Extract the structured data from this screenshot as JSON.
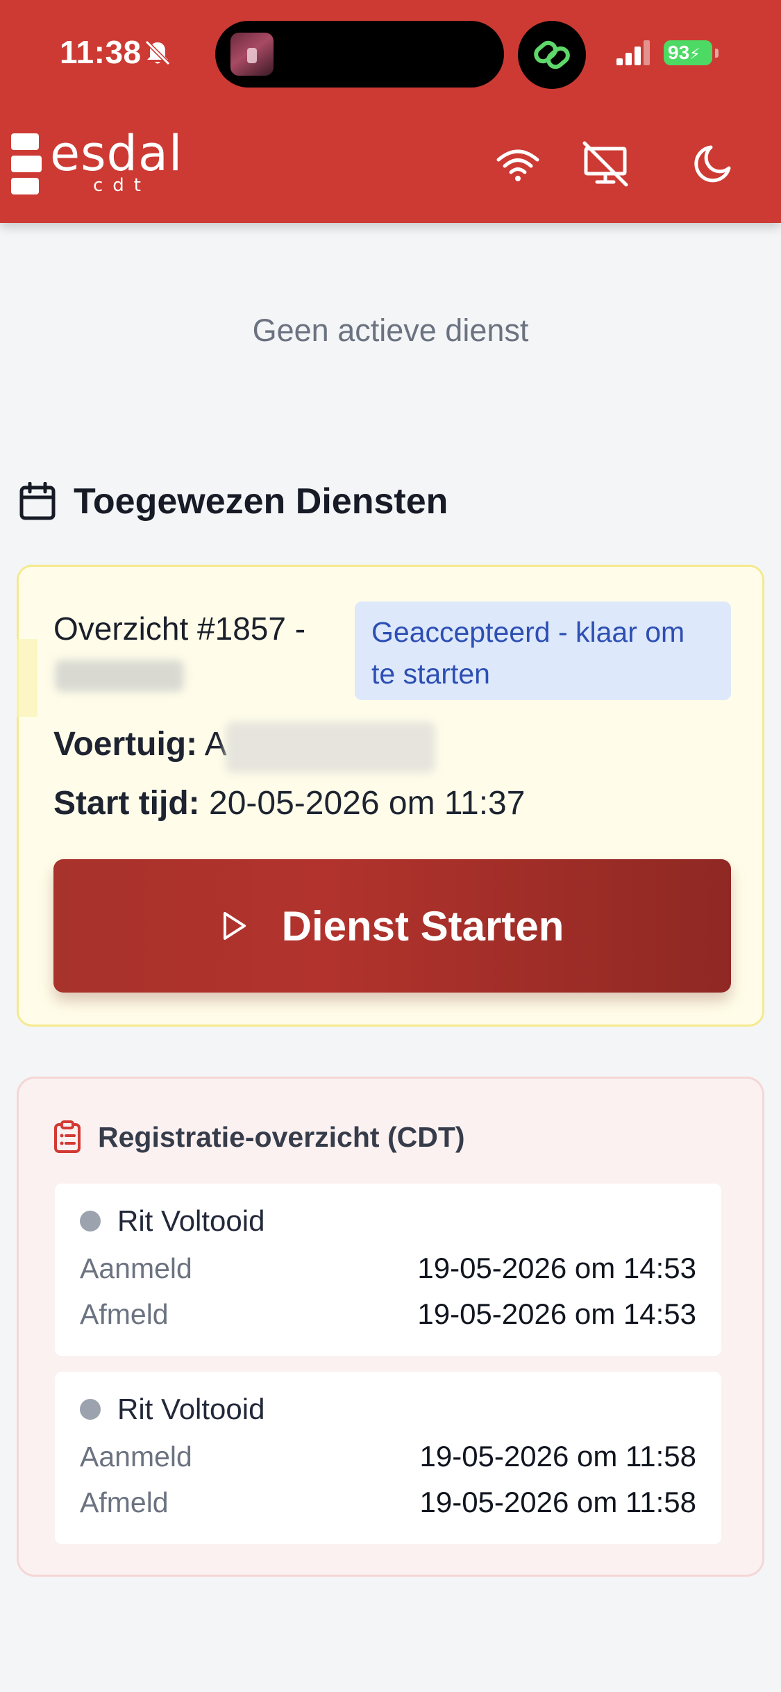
{
  "status_bar": {
    "time": "11:38",
    "battery": "93"
  },
  "header": {
    "logo_text": "esdal",
    "logo_sub": "cdt",
    "icons": [
      "wifi-icon",
      "monitor-off-icon",
      "moon-icon"
    ]
  },
  "main": {
    "no_active_service": "Geen actieve dienst",
    "section_title": "Toegewezen Diensten"
  },
  "service_card": {
    "title": "Overzicht #1857 -",
    "status_badge": "Geaccepteerd - klaar om te starten",
    "vehicle_label": "Voertuig:",
    "vehicle_value_prefix": "A",
    "start_label": "Start tijd:",
    "start_value": "20-05-2026 om 11:37",
    "start_button": "Dienst Starten"
  },
  "registration": {
    "title": "Registratie-overzicht (CDT)",
    "entries": [
      {
        "status": "Rit Voltooid",
        "login_label": "Aanmeld",
        "login_value": "19-05-2026 om 14:53",
        "logout_label": "Afmeld",
        "logout_value": "19-05-2026 om 14:53"
      },
      {
        "status": "Rit Voltooid",
        "login_label": "Aanmeld",
        "login_value": "19-05-2026 om 11:58",
        "logout_label": "Afmeld",
        "logout_value": "19-05-2026 om 11:58"
      }
    ]
  },
  "colors": {
    "header": "#cc3a33",
    "button": "#a8322c",
    "badge_bg": "#dde8fb",
    "badge_text": "#2d4fb3",
    "card_bg": "#fffde9"
  }
}
